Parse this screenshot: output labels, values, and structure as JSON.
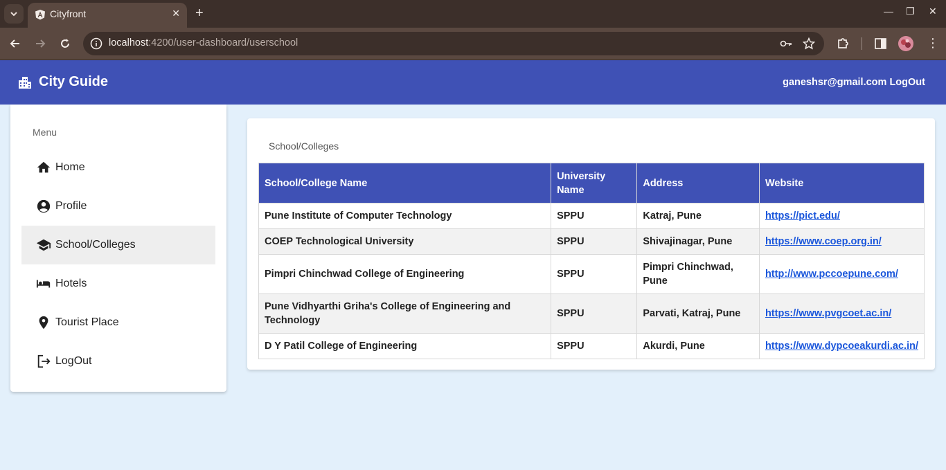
{
  "browser": {
    "tab_title": "Cityfront",
    "url_host": "localhost",
    "url_path": ":4200/user-dashboard/userschool"
  },
  "header": {
    "brand": "City Guide",
    "user_email": "ganeshsr@gmail.com",
    "logout": "LogOut"
  },
  "sidebar": {
    "title": "Menu",
    "items": [
      {
        "label": "Home",
        "icon": "home-icon"
      },
      {
        "label": "Profile",
        "icon": "account-circle-icon"
      },
      {
        "label": "School/Colleges",
        "icon": "school-icon",
        "active": true
      },
      {
        "label": "Hotels",
        "icon": "hotel-icon"
      },
      {
        "label": "Tourist Place",
        "icon": "location-pin-icon"
      },
      {
        "label": "LogOut",
        "icon": "logout-icon"
      }
    ]
  },
  "main": {
    "title": "School/Colleges",
    "columns": [
      "School/College Name",
      "University Name",
      "Address",
      "Website"
    ],
    "rows": [
      {
        "name": "Pune Institute of Computer Technology",
        "university": "SPPU",
        "address": "Katraj, Pune",
        "website": "https://pict.edu/"
      },
      {
        "name": "COEP Technological University",
        "university": "SPPU",
        "address": "Shivajinagar, Pune",
        "website": "https://www.coep.org.in/"
      },
      {
        "name": "Pimpri Chinchwad College of Engineering",
        "university": "SPPU",
        "address": "Pimpri Chinchwad, Pune",
        "website": "http://www.pccoepune.com/"
      },
      {
        "name": "Pune Vidhyarthi Griha's College of Engineering and Technology",
        "university": "SPPU",
        "address": "Parvati, Katraj, Pune",
        "website": "https://www.pvgcoet.ac.in/"
      },
      {
        "name": "D Y Patil College of Engineering",
        "university": "SPPU",
        "address": "Akurdi, Pune",
        "website": "https://www.dypcoeakurdi.ac.in/"
      }
    ]
  },
  "colors": {
    "primary": "#3f51b5",
    "background": "#e3f0fb",
    "link": "#1a56db"
  }
}
